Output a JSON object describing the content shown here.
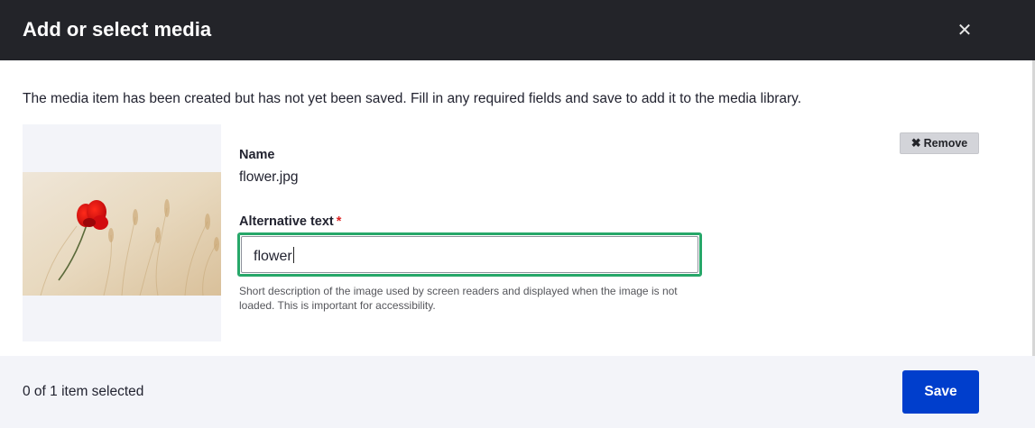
{
  "dialog": {
    "title": "Add or select media",
    "close_icon": "close-icon"
  },
  "notice": "The media item has been created but has not yet been saved. Fill in any required fields and save to add it to the media library.",
  "media": {
    "image_description": "poppy-in-wheat-field",
    "remove_label": "Remove",
    "name_label": "Name",
    "name_value": "flower.jpg",
    "alt_label": "Alternative text",
    "required_mark": "*",
    "alt_value": "flower",
    "alt_help": "Short description of the image used by screen readers and displayed when the image is not loaded. This is important for accessibility."
  },
  "footer": {
    "selection_status": "0 of 1 item selected",
    "save_label": "Save"
  },
  "colors": {
    "titlebar": "#232429",
    "primary_button": "#003ecc",
    "focus_border": "#26a769",
    "required": "#dc2323"
  }
}
